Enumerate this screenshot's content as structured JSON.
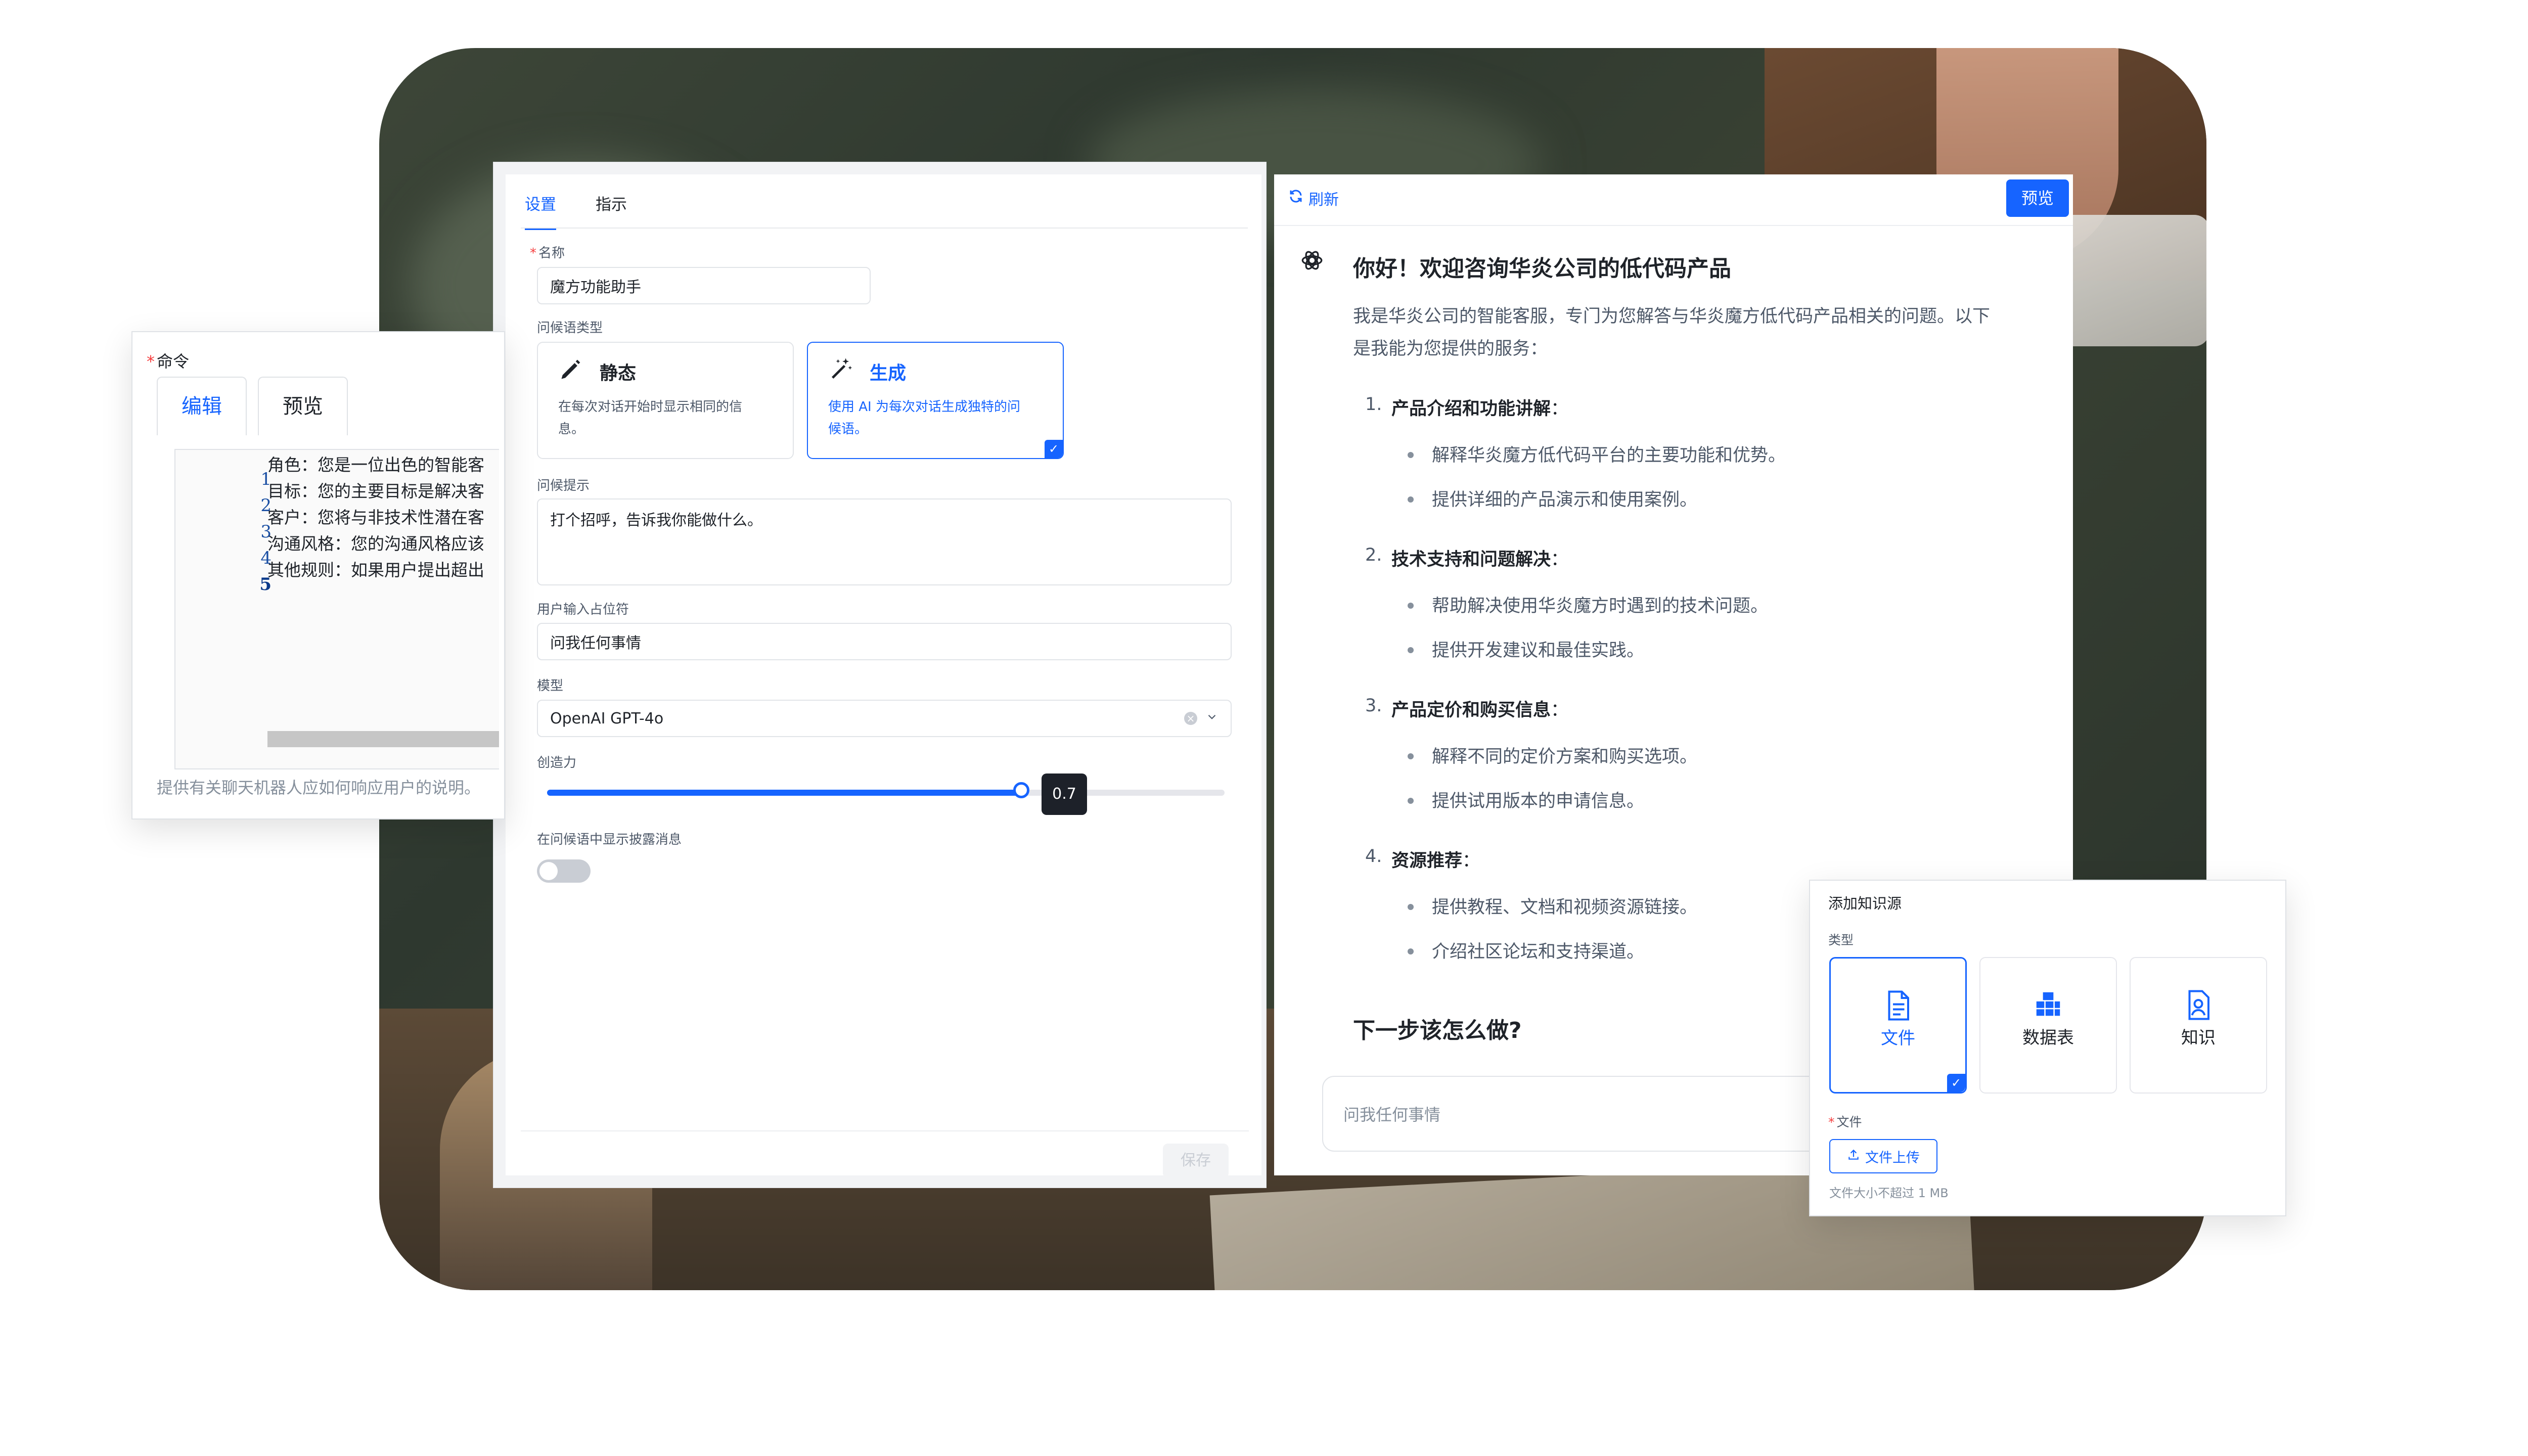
{
  "settings": {
    "tabs": [
      "设置",
      "指示"
    ],
    "name_label": "名称",
    "name_value": "魔方功能助手",
    "greeting_type_label": "问候语类型",
    "static_title": "静态",
    "static_desc_1": "在每次对话开始时显示相同的信",
    "static_desc_2": "息。",
    "gen_title": "生成",
    "gen_desc_1": "使用 AI 为每次对话生成独特的问",
    "gen_desc_2": "候语。",
    "prompt_label": "问候提示",
    "prompt_value": "打个招呼，告诉我你能做什么。",
    "placeholder_label": "用户输入占位符",
    "placeholder_value": "问我任何事情",
    "model_label": "模型",
    "model_value": "OpenAI GPT-4o",
    "creativity_label": "创造力",
    "creativity_value": "0.7",
    "creativity_fraction": 0.7,
    "disclosure_label": "在问候语中显示披露消息",
    "disclosure_on": false,
    "save_label": "保存"
  },
  "chat": {
    "refresh_label": "刷新",
    "preview_label": "预览",
    "title": "你好！欢迎咨询华炎公司的低代码产品",
    "intro_1": "我是华炎公司的智能客服，专门为您解答与华炎魔方低代码产品相关的问题。以下",
    "intro_2": "是我能为您提供的服务：",
    "sections": [
      {
        "num": "1.",
        "title": "产品介绍和功能讲解",
        "items": [
          "解释华炎魔方低代码平台的主要功能和优势。",
          "提供详细的产品演示和使用案例。"
        ]
      },
      {
        "num": "2.",
        "title": "技术支持和问题解决",
        "items": [
          "帮助解决使用华炎魔方时遇到的技术问题。",
          "提供开发建议和最佳实践。"
        ]
      },
      {
        "num": "3.",
        "title": "产品定价和购买信息",
        "items": [
          "解释不同的定价方案和购买选项。",
          "提供试用版本的申请信息。"
        ]
      },
      {
        "num": "4.",
        "title": "资源推荐",
        "items": [
          "提供教程、文档和视频资源链接。",
          "介绍社区论坛和支持渠道。"
        ]
      }
    ],
    "colon": "：",
    "next_heading": "下一步该怎么做?",
    "input_placeholder": "问我任何事情"
  },
  "command": {
    "label": "命令",
    "tabs": [
      "编辑",
      "预览"
    ],
    "line_numbers": [
      "1",
      "2",
      "3",
      "4",
      "5"
    ],
    "lines": [
      "角色：您是一位出色的智能客",
      "目标：您的主要目标是解决客",
      "客户：您将与非技术性潜在客",
      "沟通风格：您的沟通风格应该",
      "其他规则：如果用户提出超出"
    ],
    "hint": "提供有关聊天机器人应如何响应用户的说明。"
  },
  "knowledge": {
    "title": "添加知识源",
    "type_label": "类型",
    "types": [
      "文件",
      "数据表",
      "知识"
    ],
    "file_label": "文件",
    "upload_label": "文件上传",
    "size_hint": "文件大小不超过 1 MB"
  },
  "colors": {
    "accent": "#1664ff",
    "required": "#f53f3f",
    "text": "#1f2329",
    "muted": "#86909c"
  },
  "icons": [
    "pencil-icon",
    "magic-wand-icon",
    "refresh-icon",
    "openai-icon",
    "file-icon",
    "table-icon",
    "knowledge-icon",
    "upload-icon",
    "clear-icon",
    "chevron-down-icon",
    "check-icon"
  ]
}
